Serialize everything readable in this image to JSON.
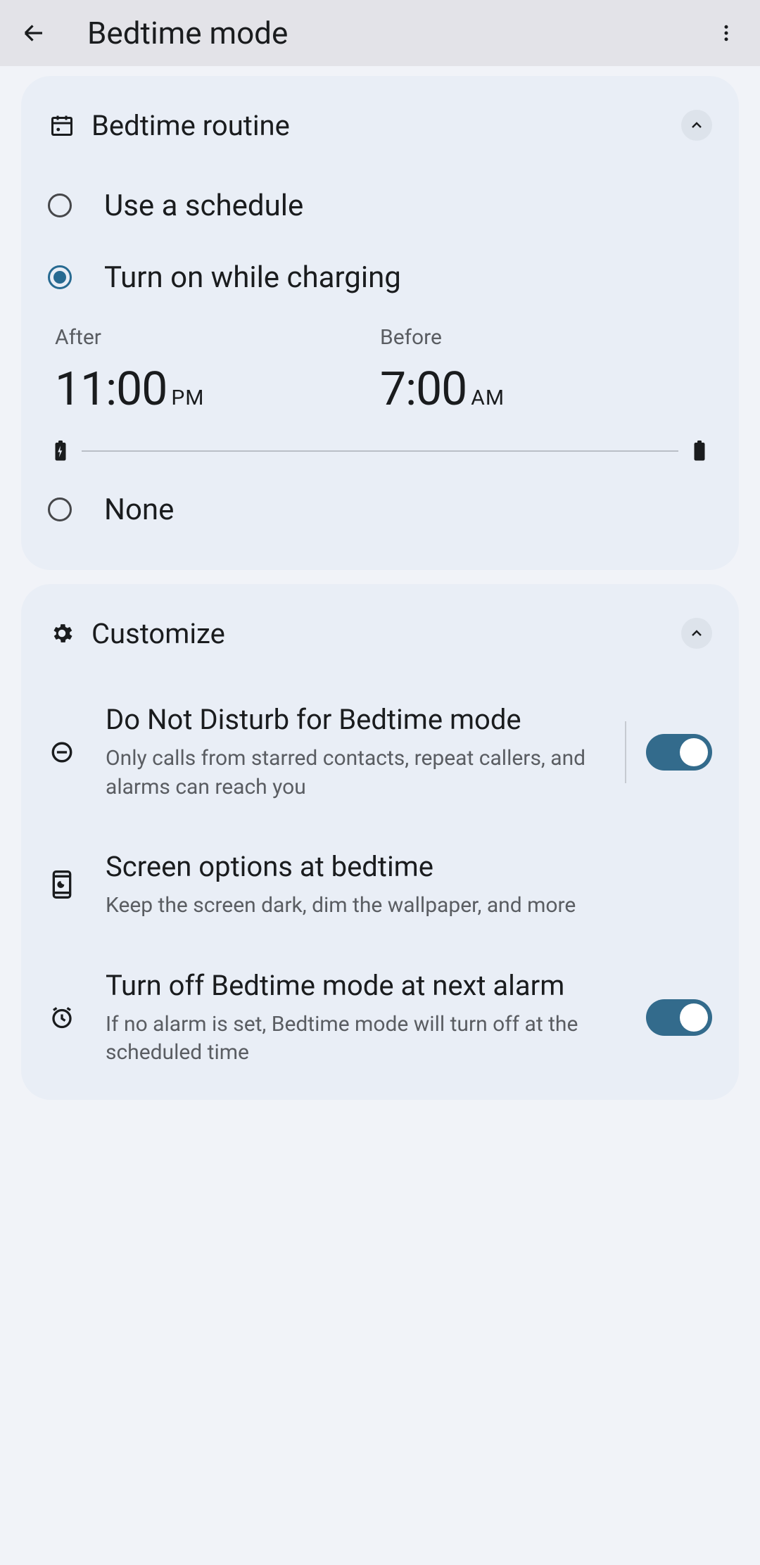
{
  "header": {
    "title": "Bedtime mode"
  },
  "routine": {
    "section_label": "Bedtime routine",
    "options": {
      "schedule": "Use a schedule",
      "charging": "Turn on while charging",
      "none": "None"
    },
    "selected": "charging",
    "after": {
      "label": "After",
      "time": "11:00",
      "ampm": "PM"
    },
    "before": {
      "label": "Before",
      "time": "7:00",
      "ampm": "AM"
    }
  },
  "customize": {
    "section_label": "Customize",
    "dnd": {
      "title": "Do Not Disturb for Bedtime mode",
      "desc": "Only calls from starred contacts, repeat callers, and alarms can reach you",
      "enabled": true
    },
    "screen": {
      "title": "Screen options at bedtime",
      "desc": "Keep the screen dark, dim the wallpaper, and more"
    },
    "turn_off_alarm": {
      "title": "Turn off Bedtime mode at next alarm",
      "desc": "If no alarm is set, Bedtime mode will turn off at the scheduled time",
      "enabled": true
    }
  },
  "colors": {
    "accent": "#336b8c"
  }
}
